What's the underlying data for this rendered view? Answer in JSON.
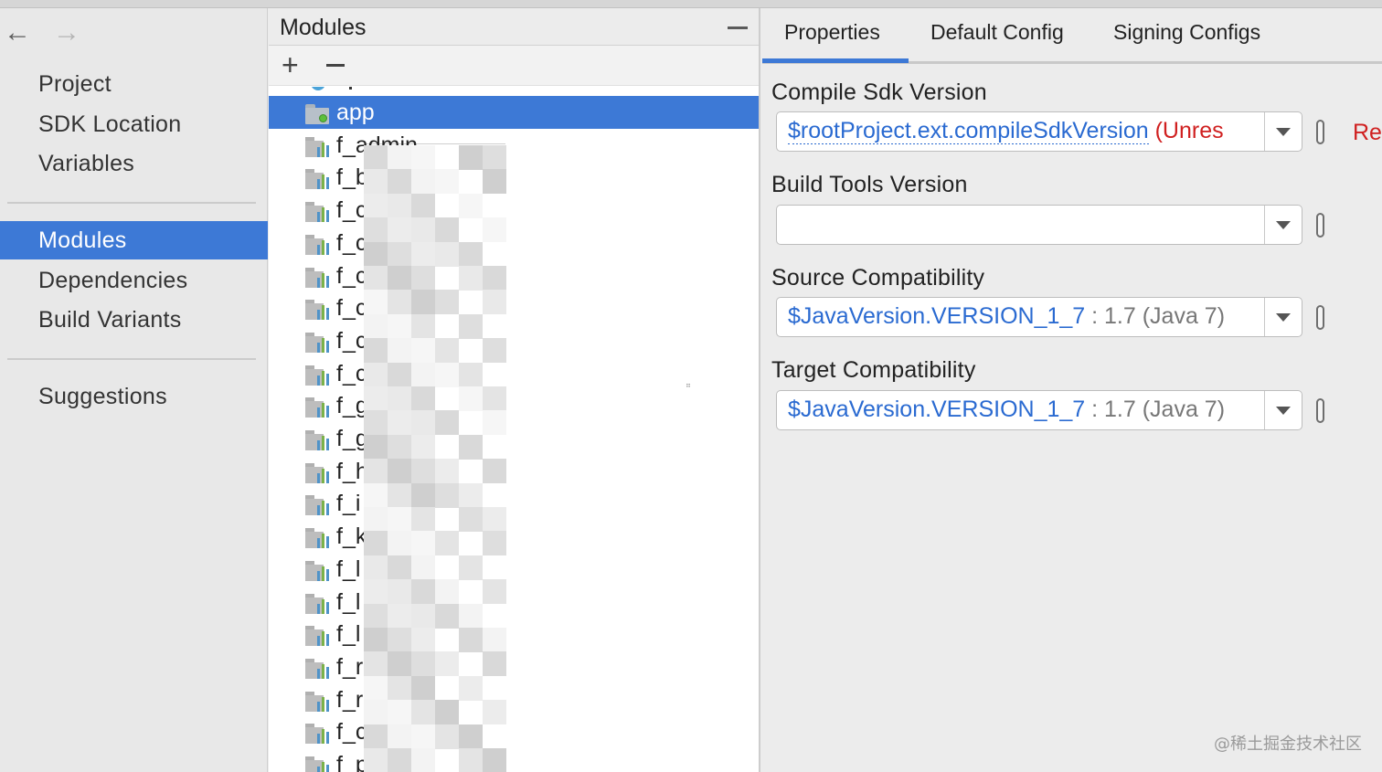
{
  "nav": {
    "items_group1": [
      "Project",
      "SDK Location",
      "Variables"
    ],
    "items_group2": [
      "Modules",
      "Dependencies",
      "Build Variants"
    ],
    "items_group3": [
      "Suggestions"
    ],
    "selected": "Modules"
  },
  "modules": {
    "title": "Modules",
    "add_label": "+",
    "tree": [
      {
        "label": "app",
        "type": "app",
        "selected": true
      },
      {
        "label": "f_admin",
        "type": "lib"
      },
      {
        "label": "f_b",
        "type": "lib"
      },
      {
        "label": "f_c",
        "type": "lib"
      },
      {
        "label": "f_c",
        "type": "lib"
      },
      {
        "label": "f_c",
        "type": "lib"
      },
      {
        "label": "f_c",
        "type": "lib"
      },
      {
        "label": "f_c",
        "type": "lib"
      },
      {
        "label": "f_c",
        "type": "lib"
      },
      {
        "label": "f_g",
        "type": "lib"
      },
      {
        "label": "f_g",
        "type": "lib"
      },
      {
        "label": "f_h",
        "type": "lib"
      },
      {
        "label": "f_i",
        "type": "lib"
      },
      {
        "label": "f_k",
        "type": "lib"
      },
      {
        "label": "f_l",
        "type": "lib"
      },
      {
        "label": "f_l",
        "type": "lib"
      },
      {
        "label": "f_l",
        "type": "lib"
      },
      {
        "label": "f_r",
        "type": "lib"
      },
      {
        "label": "f_r",
        "type": "lib"
      },
      {
        "label": "f_c",
        "type": "lib"
      },
      {
        "label": "f_p",
        "type": "lib"
      }
    ]
  },
  "tabs": [
    "Properties",
    "Default Config",
    "Signing Configs"
  ],
  "active_tab": "Properties",
  "fields": {
    "compile_sdk": {
      "label": "Compile Sdk Version",
      "value_ref": "$rootProject.ext.compileSdkVersion",
      "value_note": " (Unres",
      "side_text": "Res"
    },
    "build_tools": {
      "label": "Build Tools Version",
      "value": ""
    },
    "source_compat": {
      "label": "Source Compatibility",
      "value_ref": "$JavaVersion.VERSION_1_7",
      "value_note": " : 1.7 (Java 7)"
    },
    "target_compat": {
      "label": "Target Compatibility",
      "value_ref": "$JavaVersion.VERSION_1_7",
      "value_note": " : 1.7 (Java 7)"
    }
  },
  "watermark": "@稀土掘金技术社区",
  "colors": {
    "selection": "#3d79d6",
    "link": "#2a6ad1",
    "error": "#d02020"
  }
}
